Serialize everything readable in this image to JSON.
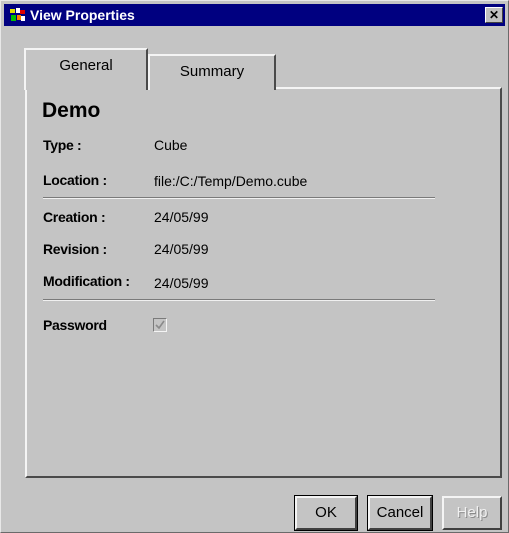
{
  "window": {
    "title": "View Properties",
    "close_label": "✕"
  },
  "tabs": [
    {
      "label": "General",
      "active": true
    },
    {
      "label": "Summary",
      "active": false
    }
  ],
  "general": {
    "name": "Demo",
    "type_label": "Type :",
    "type_value": "Cube",
    "location_label": "Location :",
    "location_value": "file:/C:/Temp/Demo.cube",
    "creation_label": "Creation :",
    "creation_value": "24/05/99",
    "revision_label": "Revision :",
    "revision_value": "24/05/99",
    "modification_label": "Modification :",
    "modification_value": "24/05/99",
    "password_label": "Password",
    "password_checked": true
  },
  "buttons": {
    "ok": "OK",
    "cancel": "Cancel",
    "help": "Help"
  },
  "colors": {
    "titlebar": "#000080",
    "background": "#c4c4c4"
  }
}
